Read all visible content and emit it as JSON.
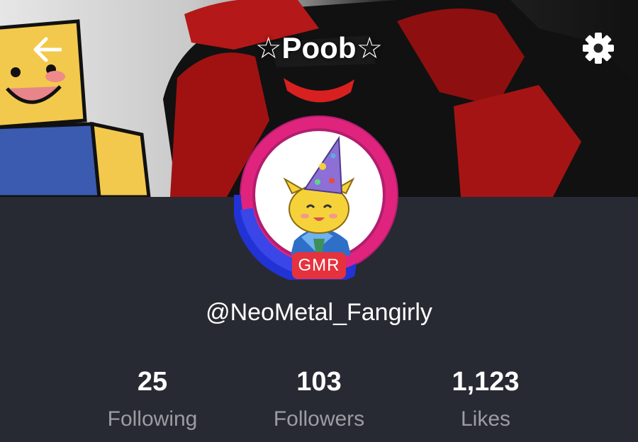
{
  "header": {
    "title": "☆Poob☆",
    "back_icon": "arrow-left-icon",
    "settings_icon": "gear-icon"
  },
  "profile": {
    "badge": "GMR",
    "username": "@NeoMetal_Fangirly"
  },
  "stats": [
    {
      "value": "25",
      "label": "Following"
    },
    {
      "value": "103",
      "label": "Followers"
    },
    {
      "value": "1,123",
      "label": "Likes"
    }
  ],
  "colors": {
    "background": "#282a33",
    "badge": "#e5323d",
    "ring_pink": "#e0247e",
    "ring_blue": "#2233d6",
    "muted_text": "#9c9da3"
  }
}
